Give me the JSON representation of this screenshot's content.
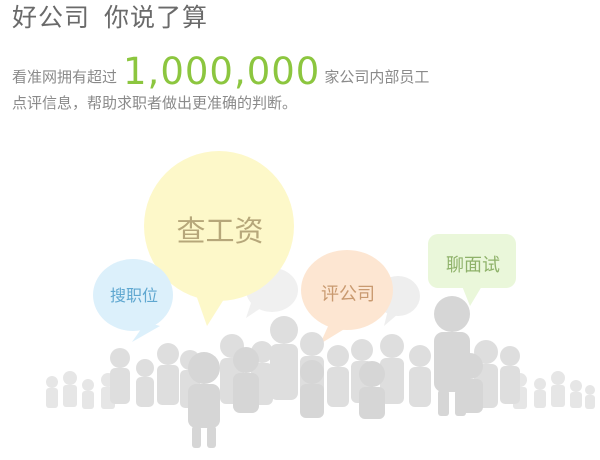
{
  "headline": {
    "part1": "好公司",
    "part2": "你说了算"
  },
  "intro": {
    "prefix": "看准网拥有超过",
    "count": "1,000,000",
    "suffix": "家公司内部员工",
    "line2": "点评信息，帮助求职者做出更准确的判断。"
  },
  "bubbles": {
    "salary": "查工资",
    "jobs": "搜职位",
    "review": "评公司",
    "interview": "聊面试"
  },
  "colors": {
    "count_green": "#8cc63f",
    "salary_bubble": "#fdf8c9",
    "jobs_bubble": "#dcf0fb",
    "review_bubble": "#fde6d2",
    "interview_bubble": "#eaf7da",
    "crowd_gray": "#d8d8d8"
  }
}
